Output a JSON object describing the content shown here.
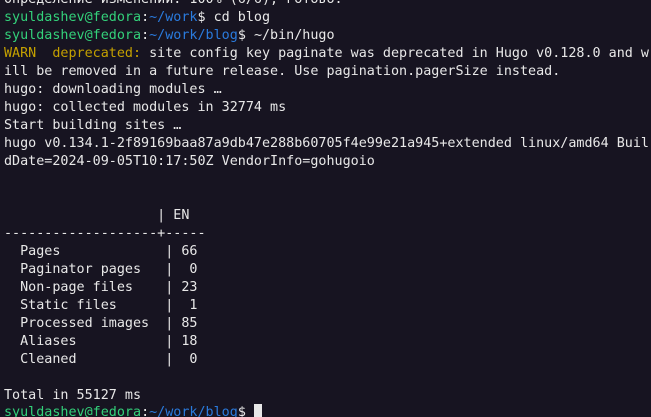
{
  "colors": {
    "background": "#171421",
    "foreground": "#e8e8e8",
    "prompt_user": "#33d17a",
    "prompt_path": "#2a7bde",
    "warning": "#c4a000"
  },
  "terminal": {
    "top_partial": "Определение изменений: 100% (6/6), готово.",
    "prompt1": {
      "user": "syuldashev@fedora",
      "sep": ":",
      "path": "~/work",
      "sym": "$ ",
      "cmd": "cd blog"
    },
    "prompt2": {
      "user": "syuldashev@fedora",
      "sep": ":",
      "path": "~/work/blog",
      "sym": "$ ",
      "cmd": "~/bin/hugo"
    },
    "warn_prefix": "WARN  deprecated:",
    "warn_line1": " site config key paginate was deprecated in Hugo v0.128.0 and w",
    "warn_line2": "ill be removed in a future release. Use pagination.pagerSize instead.",
    "log_downloading": "hugo: downloading modules …",
    "log_collected": "hugo: collected modules in 32774 ms",
    "log_start": "Start building sites …",
    "version_line1": "hugo v0.134.1-2f89169baa87a9db47e288b60705f4e99e21a945+extended linux/amd64 Buil",
    "version_line2": "dDate=2024-09-05T10:17:50Z VendorInfo=gohugoio",
    "table": {
      "header": "                   | EN",
      "separator": "-------------------+-----",
      "rows": [
        "  Pages             | 66",
        "  Paginator pages   |  0",
        "  Non-page files    | 23",
        "  Static files      |  1",
        "  Processed images  | 85",
        "  Aliases           | 18",
        "  Cleaned           |  0"
      ]
    },
    "total": "Total in 55127 ms",
    "prompt3": {
      "user": "syuldashev@fedora",
      "sep": ":",
      "path": "~/work/blog",
      "sym": "$ "
    }
  }
}
